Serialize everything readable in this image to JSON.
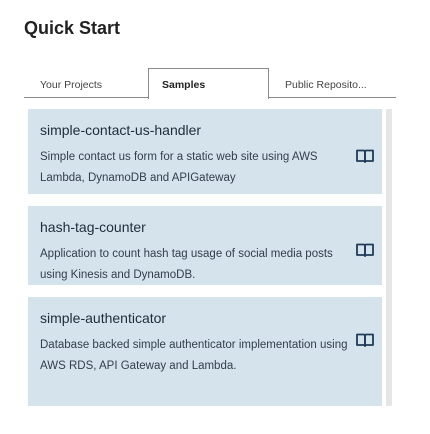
{
  "header": {
    "title": "Quick Start"
  },
  "tabs": [
    {
      "label": "Your Projects",
      "active": false
    },
    {
      "label": "Samples",
      "active": true
    },
    {
      "label": "Public Reposito...",
      "active": false
    }
  ],
  "samples": [
    {
      "name": "simple-contact-us-handler",
      "description": "Simple contact us form for a static web site using AWS Lambda, DynamoDB and APIGateway",
      "icon": "book-icon"
    },
    {
      "name": "hash-tag-counter",
      "description": "Application to count hash tag usage of social media posts using Kinesis and DynamoDB.",
      "icon": "book-icon"
    },
    {
      "name": "simple-authenticator",
      "description": "Database backed simple authenticator implementation using AWS RDS, API Gateway and Lambda.",
      "icon": "book-icon"
    }
  ],
  "colors": {
    "card_background": "#d5e3ed",
    "icon": "#1f3b57"
  }
}
